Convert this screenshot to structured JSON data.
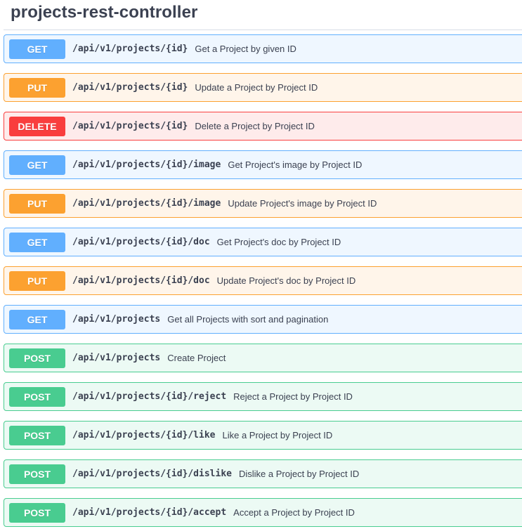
{
  "tag": {
    "title": "projects-rest-controller"
  },
  "operations": [
    {
      "method": "GET",
      "path": "/api/v1/projects/{id}",
      "summary": "Get a Project by given ID"
    },
    {
      "method": "PUT",
      "path": "/api/v1/projects/{id}",
      "summary": "Update a Project by Project ID"
    },
    {
      "method": "DELETE",
      "path": "/api/v1/projects/{id}",
      "summary": "Delete a Project by Project ID"
    },
    {
      "method": "GET",
      "path": "/api/v1/projects/{id}/image",
      "summary": "Get Project's image by Project ID"
    },
    {
      "method": "PUT",
      "path": "/api/v1/projects/{id}/image",
      "summary": "Update Project's image by Project ID"
    },
    {
      "method": "GET",
      "path": "/api/v1/projects/{id}/doc",
      "summary": "Get Project's doc by Project ID"
    },
    {
      "method": "PUT",
      "path": "/api/v1/projects/{id}/doc",
      "summary": "Update Project's doc by Project ID"
    },
    {
      "method": "GET",
      "path": "/api/v1/projects",
      "summary": "Get all Projects with sort and pagination"
    },
    {
      "method": "POST",
      "path": "/api/v1/projects",
      "summary": "Create Project"
    },
    {
      "method": "POST",
      "path": "/api/v1/projects/{id}/reject",
      "summary": "Reject a Project by Project ID"
    },
    {
      "method": "POST",
      "path": "/api/v1/projects/{id}/like",
      "summary": "Like a Project by Project ID"
    },
    {
      "method": "POST",
      "path": "/api/v1/projects/{id}/dislike",
      "summary": "Dislike a Project by Project ID"
    },
    {
      "method": "POST",
      "path": "/api/v1/projects/{id}/accept",
      "summary": "Accept a Project by Project ID"
    }
  ],
  "colors": {
    "get": "#61affe",
    "put": "#fca130",
    "delete": "#f93e3e",
    "post": "#49cc90",
    "text": "#3b4151"
  }
}
